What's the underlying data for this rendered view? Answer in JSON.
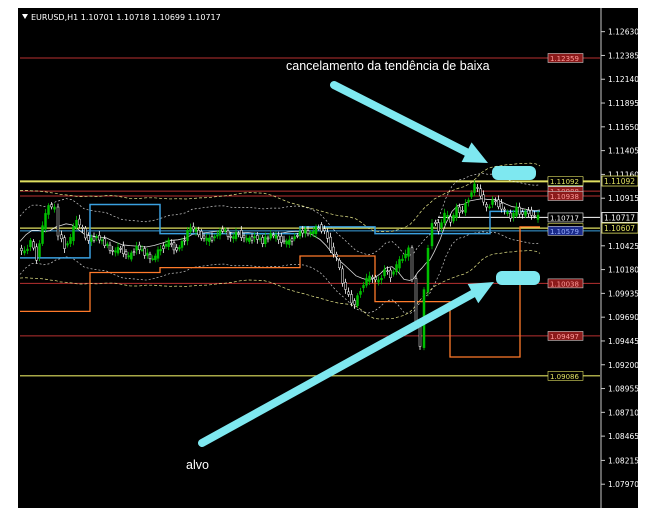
{
  "header": {
    "symbol_info": "EURUSD,H1  1.10701 1.10718 1.10699 1.10717"
  },
  "annotations": {
    "top": "cancelamento da tendência de baixa",
    "bottom": "alvo"
  },
  "colors": {
    "background": "#000000",
    "bullish_candle": "#00c000",
    "arrow": "#7ee8f0",
    "target_box": "#7ee8f0",
    "bollinger": "#ffffff",
    "ma_dashed": "#e6e68a",
    "blue_line": "#3aa0e0",
    "orange_line": "#ff7a2a",
    "red_level": "#b83030",
    "yellow_level": "#e0e060"
  },
  "chart_data": {
    "type": "candlestick",
    "symbol": "EURUSD",
    "timeframe": "H1",
    "ohlc_header": {
      "open": 1.10701,
      "high": 1.10718,
      "low": 1.10699,
      "close": 1.10717
    },
    "y_ticks": [
      "1.12630",
      "1.12385",
      "1.12140",
      "1.11895",
      "1.11650",
      "1.11405",
      "1.11160",
      "1.10915",
      "1.10670",
      "1.10425",
      "1.10180",
      "1.09935",
      "1.09690",
      "1.09445",
      "1.09200",
      "1.08955",
      "1.08710",
      "1.08465",
      "1.08215",
      "1.07970"
    ],
    "ylim": [
      1.079,
      1.1275
    ],
    "levels": [
      {
        "label": "1.12359",
        "value": 1.12359,
        "color": "#b83030",
        "box": "#8b1a1a"
      },
      {
        "label": "1.11084",
        "value": 1.11084,
        "color": "#e0e060",
        "box": "#1a8080"
      },
      {
        "label": "1.11092",
        "value": 1.11092,
        "color": "#e0e060",
        "box": "#e0e060"
      },
      {
        "label": "1.10988",
        "value": 1.10988,
        "color": "#b83030",
        "box": "#8b1a1a"
      },
      {
        "label": "1.10938",
        "value": 1.10938,
        "color": "#b83030",
        "box": "#8b1a1a"
      },
      {
        "label": "1.10717",
        "value": 1.10717,
        "color": "#ffffff",
        "box": "#ffffff"
      },
      {
        "label": "1.10607",
        "value": 1.10607,
        "color": "#e0e060",
        "box": "#e0e060"
      },
      {
        "label": "1.10579",
        "value": 1.10579,
        "color": "#3aa0e0",
        "box": "#1a2a8a"
      },
      {
        "label": "1.10038",
        "value": 1.10038,
        "color": "#b83030",
        "box": "#8b1a1a"
      },
      {
        "label": "1.09497",
        "value": 1.09497,
        "color": "#b83030",
        "box": "#8b1a1a"
      },
      {
        "label": "1.09086",
        "value": 1.09086,
        "color": "#e0e060",
        "box": "#e0e060"
      }
    ],
    "price_path": [
      [
        0,
        1.104
      ],
      [
        6,
        1.1035
      ],
      [
        12,
        1.1048
      ],
      [
        18,
        1.103
      ],
      [
        24,
        1.1062
      ],
      [
        30,
        1.1085
      ],
      [
        36,
        1.108
      ],
      [
        40,
        1.1055
      ],
      [
        46,
        1.1042
      ],
      [
        52,
        1.105
      ],
      [
        58,
        1.107
      ],
      [
        64,
        1.1058
      ],
      [
        70,
        1.1048
      ],
      [
        78,
        1.1052
      ],
      [
        86,
        1.1045
      ],
      [
        94,
        1.1036
      ],
      [
        102,
        1.104
      ],
      [
        110,
        1.103
      ],
      [
        118,
        1.1042
      ],
      [
        126,
        1.1035
      ],
      [
        134,
        1.1028
      ],
      [
        142,
        1.104
      ],
      [
        150,
        1.1046
      ],
      [
        158,
        1.1038
      ],
      [
        166,
        1.105
      ],
      [
        172,
        1.1062
      ],
      [
        180,
        1.1055
      ],
      [
        188,
        1.1048
      ],
      [
        196,
        1.1052
      ],
      [
        204,
        1.106
      ],
      [
        212,
        1.105
      ],
      [
        220,
        1.1056
      ],
      [
        228,
        1.1048
      ],
      [
        236,
        1.1052
      ],
      [
        244,
        1.1047
      ],
      [
        252,
        1.1054
      ],
      [
        260,
        1.105
      ],
      [
        268,
        1.1045
      ],
      [
        276,
        1.1052
      ],
      [
        284,
        1.1058
      ],
      [
        292,
        1.1055
      ],
      [
        300,
        1.1062
      ],
      [
        306,
        1.1058
      ],
      [
        312,
        1.104
      ],
      [
        318,
        1.103
      ],
      [
        324,
        1.1005
      ],
      [
        330,
        1.099
      ],
      [
        336,
        1.0982
      ],
      [
        342,
        1.0998
      ],
      [
        348,
        1.1008
      ],
      [
        354,
        1.101
      ],
      [
        360,
        1.1005
      ],
      [
        366,
        1.1018
      ],
      [
        372,
        1.1012
      ],
      [
        378,
        1.1022
      ],
      [
        384,
        1.103
      ],
      [
        390,
        1.1038
      ],
      [
        394,
        1.101
      ],
      [
        398,
        1.096
      ],
      [
        402,
        1.094
      ],
      [
        406,
        1.0995
      ],
      [
        410,
        1.104
      ],
      [
        414,
        1.1068
      ],
      [
        420,
        1.106
      ],
      [
        426,
        1.1075
      ],
      [
        432,
        1.1068
      ],
      [
        438,
        1.108
      ],
      [
        444,
        1.1078
      ],
      [
        450,
        1.1092
      ],
      [
        456,
        1.1105
      ],
      [
        462,
        1.1095
      ],
      [
        468,
        1.108
      ],
      [
        474,
        1.109
      ],
      [
        480,
        1.1085
      ],
      [
        486,
        1.1078
      ],
      [
        492,
        1.1072
      ],
      [
        498,
        1.108
      ],
      [
        504,
        1.1075
      ],
      [
        510,
        1.1078
      ],
      [
        516,
        1.1072
      ],
      [
        520,
        1.10717
      ]
    ],
    "blue_line": [
      [
        0,
        1.103
      ],
      [
        70,
        1.103
      ],
      [
        70,
        1.1085
      ],
      [
        140,
        1.1085
      ],
      [
        140,
        1.1055
      ],
      [
        280,
        1.1055
      ],
      [
        280,
        1.1062
      ],
      [
        355,
        1.1062
      ],
      [
        355,
        1.1055
      ],
      [
        470,
        1.1055
      ],
      [
        470,
        1.1078
      ],
      [
        520,
        1.1078
      ]
    ],
    "orange_line": [
      [
        0,
        1.0975
      ],
      [
        70,
        1.0975
      ],
      [
        70,
        1.1015
      ],
      [
        140,
        1.1015
      ],
      [
        140,
        1.102
      ],
      [
        280,
        1.102
      ],
      [
        280,
        1.1032
      ],
      [
        355,
        1.1032
      ],
      [
        355,
        1.0985
      ],
      [
        430,
        1.0985
      ],
      [
        430,
        1.0928
      ],
      [
        500,
        1.0928
      ],
      [
        500,
        1.1062
      ],
      [
        520,
        1.1062
      ]
    ]
  }
}
